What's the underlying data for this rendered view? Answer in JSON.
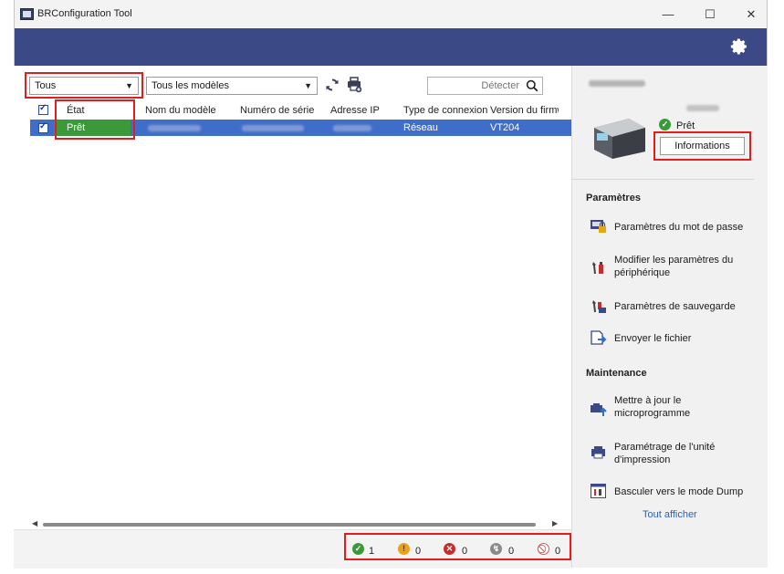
{
  "window": {
    "title": "BRConfiguration Tool"
  },
  "toolbar": {
    "filter_status": "Tous",
    "filter_models": "Tous les modèles",
    "search_placeholder": "Détecter"
  },
  "table": {
    "headers": [
      "État",
      "Nom du modèle",
      "Numéro de série",
      "Adresse IP",
      "Type de connexion",
      "Version du firmwa"
    ],
    "rows": [
      {
        "status": "Prêt",
        "connection": "Réseau",
        "firmware": "VT204"
      }
    ]
  },
  "device_panel": {
    "status": "Prêt",
    "info_button": "Informations"
  },
  "settings": {
    "title": "Paramètres",
    "items": [
      {
        "label": "Paramètres du mot de passe"
      },
      {
        "label": "Modifier les paramètres du\npériphérique"
      },
      {
        "label": "Paramètres de sauvegarde"
      },
      {
        "label": "Envoyer le fichier"
      }
    ]
  },
  "maintenance": {
    "title": "Maintenance",
    "items": [
      {
        "label": "Mettre à jour le\nmicroprogramme"
      },
      {
        "label": "Paramétrage de l'unité\nd'impression"
      },
      {
        "label": "Basculer vers le mode Dump"
      }
    ],
    "show_all": "Tout afficher"
  },
  "statusbar": {
    "ok_count": "1",
    "warning_count": "0",
    "error_count": "0",
    "offline_count": "0",
    "disabled_count": "0"
  },
  "colors": {
    "accent_band": "#3b4a86",
    "selection": "#3f6ec9",
    "status_ready": "#3a9a3a",
    "highlight": "#e01e1e"
  },
  "icons": [
    "gear-icon",
    "refresh-icon",
    "printer-add-icon",
    "search-icon",
    "check-circle-icon",
    "warning-icon",
    "error-icon",
    "offline-icon",
    "disabled-icon"
  ]
}
